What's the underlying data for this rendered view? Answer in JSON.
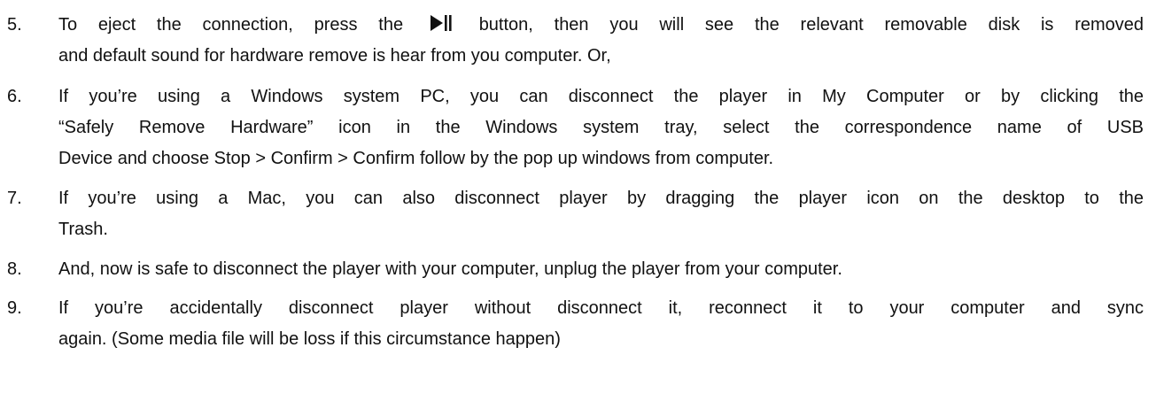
{
  "document": {
    "items": [
      {
        "number": "5.",
        "line1_before_icon": "To eject the connection, press the",
        "icon": "play-pause-icon",
        "line1_after_icon": "button, then you will see the relevant removable disk is removed",
        "line2": "and default sound for hardware remove is hear from you computer. Or,"
      },
      {
        "number": "6.",
        "lines": [
          "If you’re using a Windows system PC, you can disconnect the player in My Computer or by clicking the",
          "“Safely Remove Hardware” icon in the Windows system tray, select the correspondence name of USB",
          "Device and choose Stop > Confirm > Confirm follow by the pop up windows from computer."
        ]
      },
      {
        "number": "7.",
        "lines": [
          "If you’re using a Mac, you can also disconnect player by dragging the player icon on the desktop to the",
          "Trash."
        ]
      },
      {
        "number": "8.",
        "lines": [
          "And, now is safe to disconnect the player with your computer, unplug the player from your computer."
        ]
      },
      {
        "number": "9.",
        "lines": [
          "If you’re accidentally disconnect player without disconnect it, reconnect it to your computer and sync",
          "again. (Some media file will be loss if this circumstance happen)"
        ]
      }
    ]
  }
}
